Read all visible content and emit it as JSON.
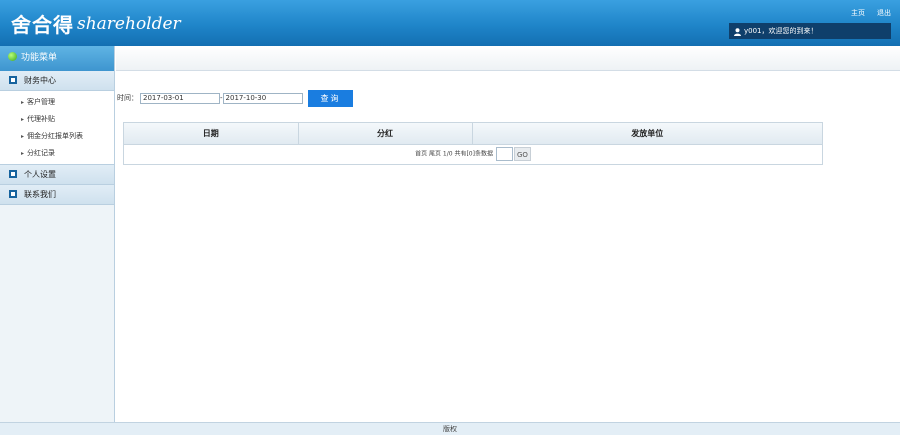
{
  "header": {
    "logo_cn": "舍合得",
    "logo_en": "shareholder",
    "links": [
      "主页",
      "退出"
    ],
    "welcome": "y001，欢迎您的到来！"
  },
  "sidebar": {
    "title": "功能菜单",
    "sections": [
      {
        "label": "财务中心",
        "items": [
          "客户管理",
          "代理补贴",
          "佣金分红报单列表",
          "分红记录"
        ]
      },
      {
        "label": "个人设置"
      },
      {
        "label": "联系我们"
      }
    ]
  },
  "filter": {
    "label": "时间：",
    "start_date": "2017-03-01",
    "separator": "-",
    "end_date": "2017-10-30",
    "query_button": "查询"
  },
  "table": {
    "columns": [
      "日期",
      "分红",
      "发放单位"
    ],
    "pager_text": "首页 尾页 1/0 共有[0]条数据",
    "go_label": "GO"
  },
  "footer": {
    "text": "版权"
  },
  "colors": {
    "header_blue": "#1f85c9",
    "button_blue": "#1a7de0",
    "welcome_bar": "#0f3f6b"
  }
}
